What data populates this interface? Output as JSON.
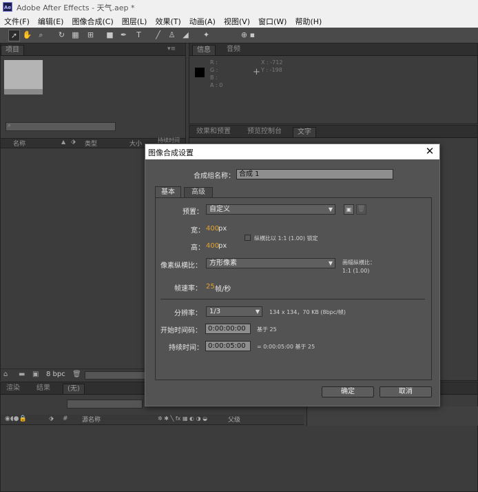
{
  "window": {
    "title": "Adobe After Effects - 天气.aep *",
    "app_icon": "Ae"
  },
  "menu": [
    "文件(F)",
    "编辑(E)",
    "图像合成(C)",
    "图层(L)",
    "效果(T)",
    "动画(A)",
    "视图(V)",
    "窗口(W)",
    "帮助(H)"
  ],
  "project_panel": {
    "tab": "项目",
    "columns": {
      "name": "名称",
      "type": "类型",
      "size": "大小",
      "duration": "持续时间"
    },
    "bpc": "8 bpc"
  },
  "info_panel": {
    "tabs": [
      "信息",
      "音频"
    ],
    "r": "R :",
    "g": "G :",
    "b": "B :",
    "a": "A :",
    "a_val": "0",
    "x": "X : -712",
    "y": "Y : -198"
  },
  "effects_panel": {
    "tabs": [
      "效果和预置",
      "预览控制台",
      "文字"
    ]
  },
  "timeline": {
    "tabs": [
      "渲染",
      "结果",
      "(无)"
    ],
    "source_name": "源名称",
    "parent": "父级"
  },
  "dialog": {
    "title": "图像合成设置",
    "name_label": "合成组名称：",
    "name_value": "合成 1",
    "tabs": {
      "basic": "基本",
      "advanced": "高级"
    },
    "preset_label": "预置：",
    "preset_value": "自定义",
    "width_label": "宽：",
    "width_value": "400",
    "width_unit": "px",
    "height_label": "高：",
    "height_value": "400",
    "height_unit": "px",
    "lock_aspect": "纵横比以 1:1 (1.00) 锁定",
    "par_label": "像素纵横比：",
    "par_value": "方形像素",
    "frame_aspect_label": "画幅纵横比：",
    "frame_aspect_value": "1:1 (1.00)",
    "fps_label": "帧速率：",
    "fps_value": "25",
    "fps_unit": "帧/秒",
    "res_label": "分辨率：",
    "res_value": "1/3",
    "res_info": "134 x 134，70 KB (8bpc/帧)",
    "start_label": "开始时间码：",
    "start_value": "0:00:00:00",
    "start_base": "基于 25",
    "dur_label": "持续时间：",
    "dur_value": "0:00:05:00",
    "dur_info": "= 0:00:05:00  基于 25",
    "ok": "确定",
    "cancel": "取消"
  },
  "colors": {
    "accent": "#e3a32f",
    "panel": "#3c3c3c",
    "dialog": "#535353"
  }
}
